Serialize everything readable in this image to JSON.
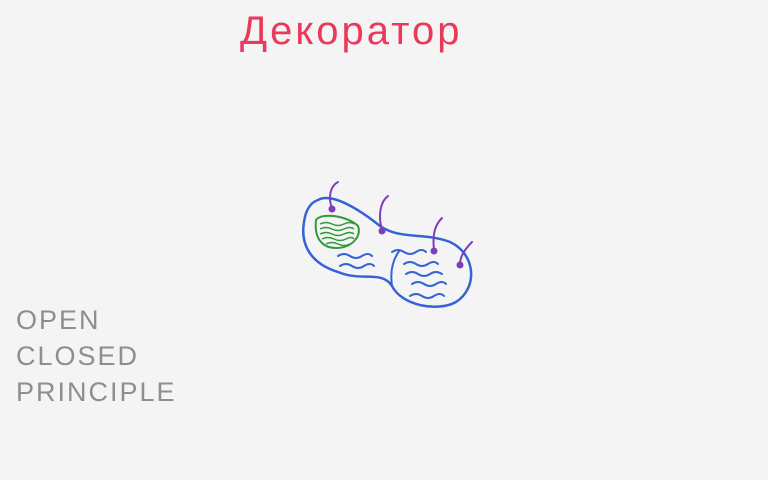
{
  "title": "Декоратор",
  "principle": {
    "line1": "OPEN",
    "line2": "CLOSED",
    "line3": "PRINCIPLE"
  },
  "colors": {
    "background": "#f4f4f4",
    "title": "#ea3a5c",
    "outline": "#3563d6",
    "hooks": "#7b3fb8",
    "inner": "#2f9a3a",
    "principle": "#8e8e8e"
  }
}
